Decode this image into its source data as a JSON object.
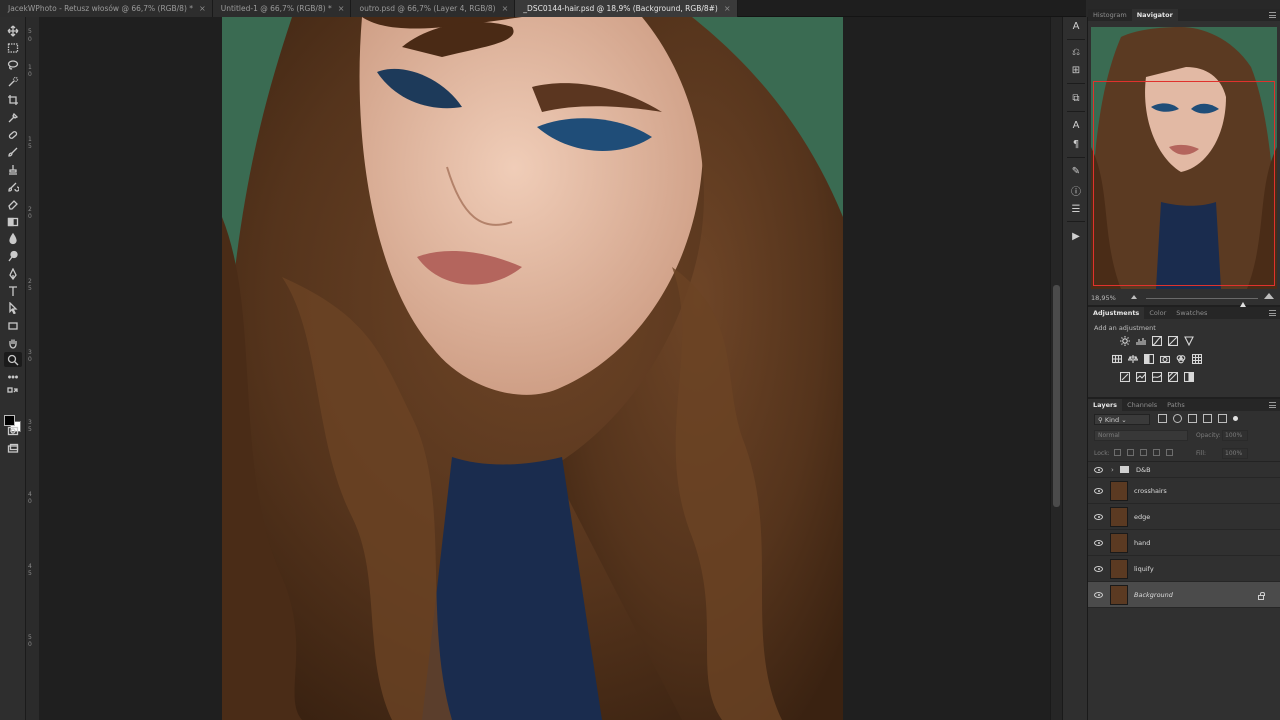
{
  "tabs": [
    {
      "label": "JacekWPhoto - Retusz włosów @ 66,7% (RGB/8) *",
      "active": false
    },
    {
      "label": "Untitled-1 @ 66,7% (RGB/8) *",
      "active": false
    },
    {
      "label": "outro.psd @ 66,7% (Layer 4, RGB/8)",
      "active": false
    },
    {
      "label": "_DSC0144-hair.psd @ 18,9% (Background, RGB/8#)",
      "active": true
    }
  ],
  "tab_close_glyph": "×",
  "toolbar": {
    "tools": [
      "move-tool",
      "marquee-tool",
      "lasso-tool",
      "quick-selection-tool",
      "crop-tool",
      "eyedropper-tool",
      "healing-brush-tool",
      "brush-tool",
      "clone-stamp-tool",
      "history-brush-tool",
      "eraser-tool",
      "gradient-tool",
      "blur-tool",
      "dodge-tool",
      "pen-tool",
      "type-tool",
      "path-selection-tool",
      "rectangle-tool",
      "hand-tool",
      "zoom-tool",
      "more-tools"
    ],
    "active_tool": "zoom-tool",
    "foreground_color": "#000000",
    "background_color": "#ffffff"
  },
  "ruler_numbers": [
    "5",
    "0",
    "1",
    "0",
    "1",
    "5",
    "2",
    "0",
    "2",
    "5",
    "3",
    "0",
    "3",
    "5",
    "4",
    "0",
    "4",
    "5",
    "5",
    "0"
  ],
  "navigator": {
    "tabs": [
      "Histogram",
      "Navigator"
    ],
    "active_tab": "Navigator",
    "zoom_text": "18,95%",
    "view_rect_color": "#e0322d"
  },
  "adjustments": {
    "tabs": [
      "Adjustments",
      "Color",
      "Swatches"
    ],
    "active_tab": "Adjustments",
    "hint": "Add an adjustment"
  },
  "layers": {
    "tabs": [
      "Layers",
      "Channels",
      "Paths"
    ],
    "active_tab": "Layers",
    "kind_label": "Kind",
    "blend_mode": "Normal",
    "opacity_label": "Opacity:",
    "opacity_value": "100%",
    "lock_label": "Lock:",
    "fill_label": "Fill:",
    "fill_value": "100%",
    "items": [
      {
        "name": "D&B",
        "type": "group",
        "visible": true,
        "selected": false
      },
      {
        "name": "crosshairs",
        "type": "layer",
        "visible": true,
        "selected": false
      },
      {
        "name": "edge",
        "type": "layer",
        "visible": true,
        "selected": false
      },
      {
        "name": "hand",
        "type": "layer",
        "visible": true,
        "selected": false
      },
      {
        "name": "liquify",
        "type": "layer",
        "visible": true,
        "selected": false
      },
      {
        "name": "Background",
        "type": "layer",
        "visible": true,
        "selected": true,
        "locked": true
      }
    ]
  },
  "dock_icons": [
    "character-styles-icon",
    "brush-settings-icon",
    "clone-source-icon",
    "paragraph-styles-icon",
    "character-icon",
    "paragraph-icon",
    "tool-presets-icon",
    "info-icon",
    "properties-icon",
    "actions-play-icon"
  ],
  "colors": {
    "backdrop_green": "#3a6b52",
    "hair_brown": "#5b3a22",
    "dress_blue": "#1a2c4e",
    "skin": "#e2b9a4"
  }
}
